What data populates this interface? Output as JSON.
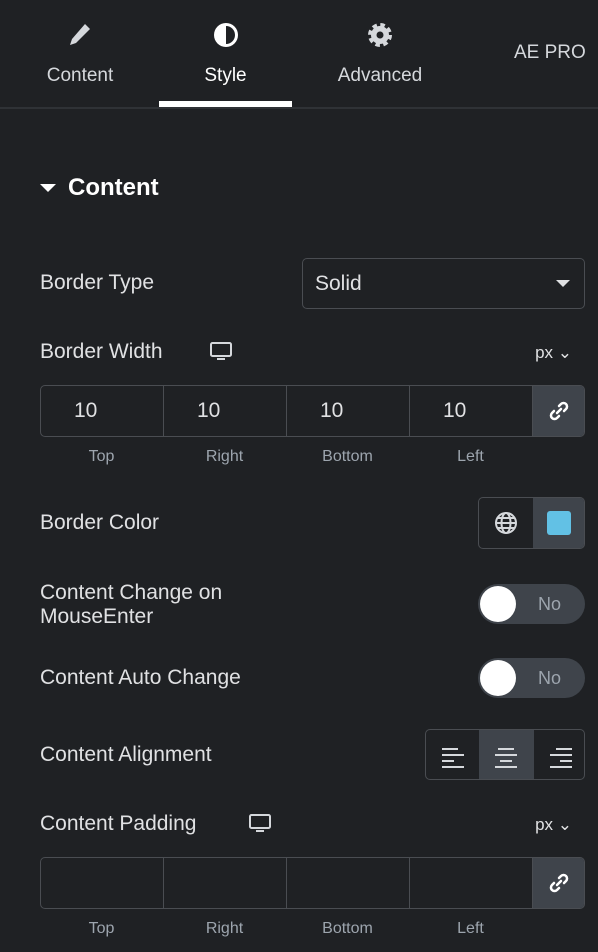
{
  "tabs": [
    {
      "label": "Content",
      "icon": "pencil-icon"
    },
    {
      "label": "Style",
      "icon": "contrast-icon",
      "active": true
    },
    {
      "label": "Advanced",
      "icon": "gear-icon"
    },
    {
      "label": "AE PRO"
    }
  ],
  "section": {
    "title": "Content",
    "expanded": true
  },
  "border_type": {
    "label": "Border Type",
    "value": "Solid"
  },
  "border_width": {
    "label": "Border Width",
    "unit": "px",
    "values": [
      "10",
      "10",
      "10",
      "10"
    ],
    "sides": [
      "Top",
      "Right",
      "Bottom",
      "Left"
    ],
    "linked": true
  },
  "border_color": {
    "label": "Border Color",
    "color": "#62c1e5"
  },
  "mouseenter": {
    "label": "Content Change on MouseEnter",
    "state": "No"
  },
  "auto_change": {
    "label": "Content Auto Change",
    "state": "No"
  },
  "alignment": {
    "label": "Content Alignment",
    "options": [
      "left",
      "center",
      "right"
    ],
    "selected": "center"
  },
  "padding": {
    "label": "Content Padding",
    "unit": "px",
    "values": [
      "",
      "",
      "",
      ""
    ],
    "sides": [
      "Top",
      "Right",
      "Bottom",
      "Left"
    ]
  }
}
